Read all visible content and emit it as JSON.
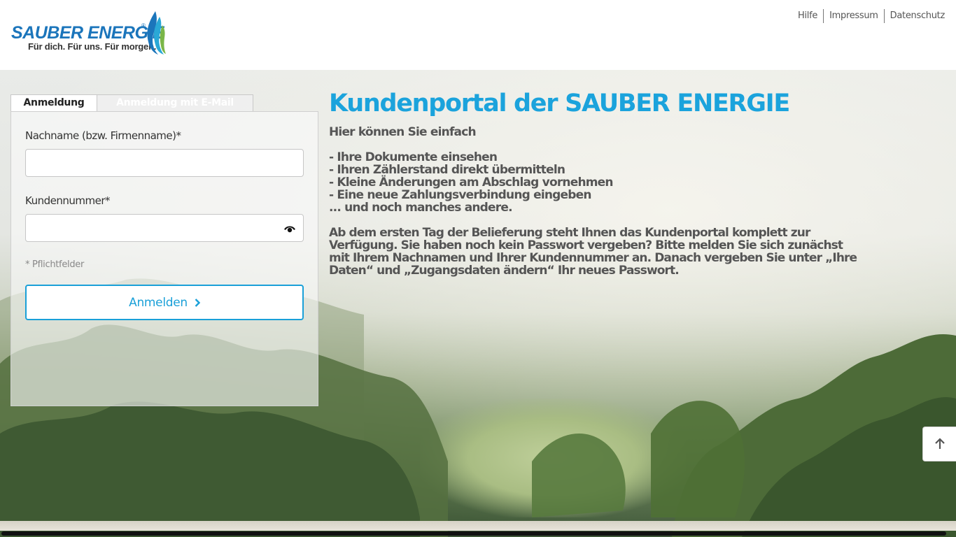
{
  "brand": {
    "name": "SAUBER ENERGIE",
    "registered": "®",
    "tagline": "Für dich. Für uns. Für morgen."
  },
  "topnav": {
    "items": [
      {
        "label": "Hilfe"
      },
      {
        "label": "Impressum"
      },
      {
        "label": "Datenschutz"
      }
    ]
  },
  "login": {
    "tabs": [
      {
        "label": "Anmeldung",
        "active": true
      },
      {
        "label": "Anmeldung mit E-Mail",
        "active": false
      }
    ],
    "name_label": "Nachname (bzw. Firmenname)*",
    "name_value": "",
    "customer_label": "Kundennummer*",
    "customer_value": "",
    "required_hint": "* Pflichtfelder",
    "submit_label": "Anmelden"
  },
  "content": {
    "title": "Kundenportal der SAUBER ENERGIE",
    "intro": "Hier können Sie einfach",
    "list": [
      "- Ihre Dokumente einsehen",
      "- Ihren Zählerstand direkt übermitteln",
      "- Kleine Änderungen am Abschlag vornehmen",
      "- Eine neue Zahlungsverbindung eingeben",
      "... und noch manches andere."
    ],
    "paragraph": "Ab dem ersten Tag der Belieferung steht Ihnen das Kundenportal komplett zur Verfügung. Sie haben noch kein Passwort vergeben? Bitte melden Sie sich zunächst mit Ihrem Nachnamen und Ihrer Kundennummer an. Danach vergeben Sie unter „Ihre Daten“ und „Zugangsdaten ändern“ Ihr neues Passwort."
  },
  "colors": {
    "accent": "#1ba3dc",
    "brand_blue": "#1b75bb",
    "text": "#555555"
  },
  "icons": {
    "password_toggle": "eye-icon",
    "submit": "chevron-right-icon",
    "scroll_top": "arrow-up-icon"
  }
}
